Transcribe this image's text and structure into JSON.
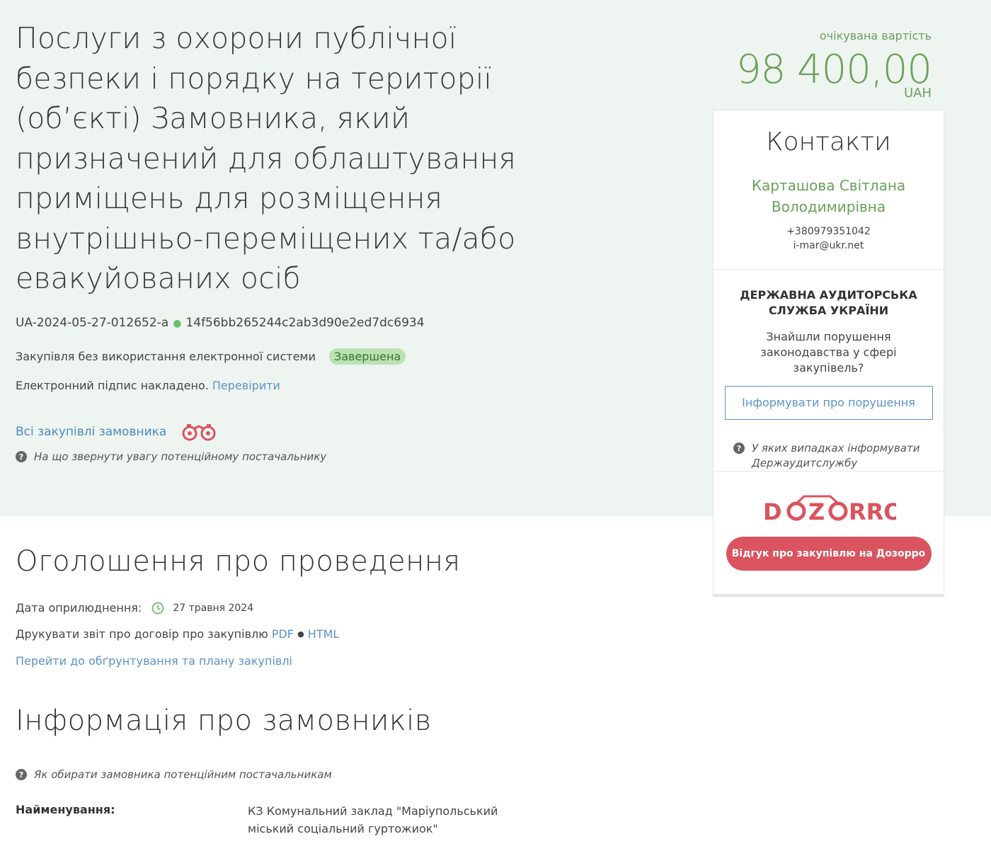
{
  "tender": {
    "title": "Послуги з охорони публічної безпеки і порядку на території (об’єкті) Замовника, який призначений для облаштування приміщень для розміщення внутрішньо-переміщених та/або евакуйованих осіб",
    "id": "UA-2024-05-27-012652-a",
    "hash": "14f56bb265244c2ab3d90e2ed7dc6934",
    "procurement_type": "Закупівля без використання електронної системи",
    "status": "Завершена",
    "signature_text": "Електронний підпис накладено.",
    "verify_link": "Перевірити",
    "all_purchases_link": "Всі закупівлі замовника",
    "attention_hint": "На що звернути увагу потенційному постачальнику"
  },
  "price": {
    "label": "очікувана вартість",
    "amount": "98 400,00",
    "currency": "UAH"
  },
  "sidebar": {
    "contacts_title": "Контакти",
    "contact_name": "Карташова Світлана Володимирівна",
    "contact_phone": "+380979351042",
    "contact_email": "i-mar@ukr.net",
    "audit_title": "ДЕРЖАВНА АУДИТОРСЬКА СЛУЖБА УКРАЇНИ",
    "audit_question": "Знайшли порушення законодавства у сфері закупівель?",
    "audit_button": "Інформувати про порушення",
    "audit_help": "У яких випадках інформувати Держаудитслужбу",
    "dozorro_logo": "DOZORRO",
    "dozorro_button": "Відгук про закупівлю на Дозорро"
  },
  "announcement": {
    "heading": "Оголошення про проведення",
    "published_label": "Дата оприлюднення:",
    "published_date": "27 травня 2024",
    "print_label": "Друкувати звіт про договір про закупівлю",
    "print_pdf": "PDF",
    "print_html": "HTML",
    "plan_link": "Перейти до обґрунтування та плану закупівлі"
  },
  "customers": {
    "heading": "Інформація про замовників",
    "hint": "Як обирати замовника потенційним постачальникам",
    "name_label": "Найменування:",
    "name_value": "КЗ Комунальний заклад \"Маріупольський міський соціальний гуртожиок\""
  },
  "colors": {
    "hero_bg": "#eef4ef",
    "accent_green": "#6aa05a",
    "link_blue": "#5a93c8",
    "dozorro_red": "#d9545f"
  }
}
